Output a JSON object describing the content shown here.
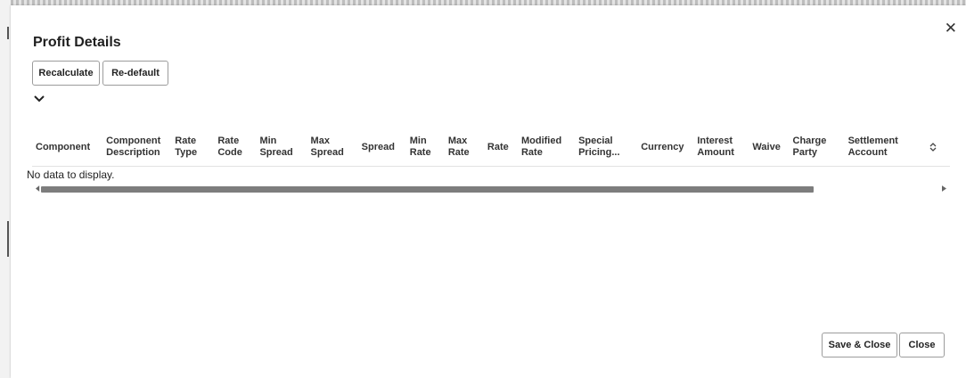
{
  "dialog": {
    "title": "Profit Details",
    "close_glyph": "✕"
  },
  "toolbar": {
    "recalculate_label": "Recalculate",
    "redefault_label": "Re-default"
  },
  "table": {
    "columns": [
      "Component",
      "Component Description",
      "Rate Type",
      "Rate Code",
      "Min Spread",
      "Max Spread",
      "Spread",
      "Min Rate",
      "Max Rate",
      "Rate",
      "Modified Rate",
      "Special Pricing...",
      "Currency",
      "Interest Amount",
      "Waive",
      "Charge Party",
      "Settlement Account"
    ],
    "empty_message": "No data to display."
  },
  "footer": {
    "save_close_label": "Save & Close",
    "close_label": "Close"
  },
  "icons": {
    "close": "close-icon",
    "expand": "chevron-down-icon",
    "sort": "sort-icon",
    "scroll_left": "scroll-left-icon",
    "scroll_right": "scroll-right-icon"
  }
}
